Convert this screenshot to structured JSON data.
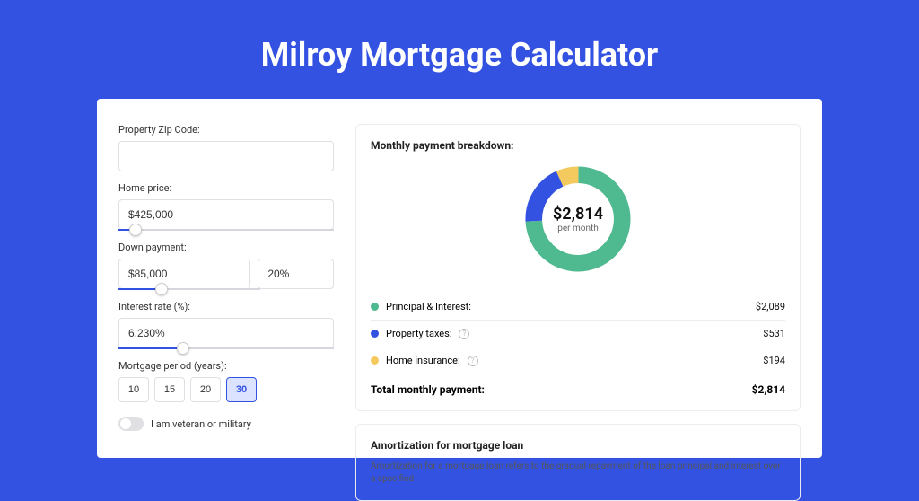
{
  "title": "Milroy Mortgage Calculator",
  "form": {
    "zip": {
      "label": "Property Zip Code:",
      "value": ""
    },
    "home_price": {
      "label": "Home price:",
      "value": "$425,000",
      "slider_pct": 8
    },
    "down_payment": {
      "label": "Down payment:",
      "amount": "$85,000",
      "pct": "20%",
      "slider_pct": 20
    },
    "interest_rate": {
      "label": "Interest rate (%):",
      "value": "6.230%",
      "slider_pct": 30
    },
    "period": {
      "label": "Mortgage period (years):",
      "options": [
        "10",
        "15",
        "20",
        "30"
      ],
      "active": "30"
    },
    "veteran": {
      "label": "I am veteran or military",
      "on": false
    }
  },
  "breakdown": {
    "title": "Monthly payment breakdown:",
    "center_amount": "$2,814",
    "center_sub": "per month",
    "items": [
      {
        "label": "Principal & Interest:",
        "value": "$2,089",
        "color": "#4fb98f",
        "info": false
      },
      {
        "label": "Property taxes:",
        "value": "$531",
        "color": "#3452e1",
        "info": true
      },
      {
        "label": "Home insurance:",
        "value": "$194",
        "color": "#f4c95d",
        "info": true
      }
    ],
    "total_label": "Total monthly payment:",
    "total_value": "$2,814"
  },
  "chart_data": {
    "type": "pie",
    "title": "Monthly payment breakdown",
    "series": [
      {
        "name": "Principal & Interest",
        "value": 2089,
        "color": "#4fb98f"
      },
      {
        "name": "Property taxes",
        "value": 531,
        "color": "#3452e1"
      },
      {
        "name": "Home insurance",
        "value": 194,
        "color": "#f4c95d"
      }
    ],
    "total": 2814,
    "unit": "USD per month"
  },
  "amortization": {
    "title": "Amortization for mortgage loan",
    "text": "Amortization for a mortgage loan refers to the gradual repayment of the loan principal and interest over a specified"
  }
}
